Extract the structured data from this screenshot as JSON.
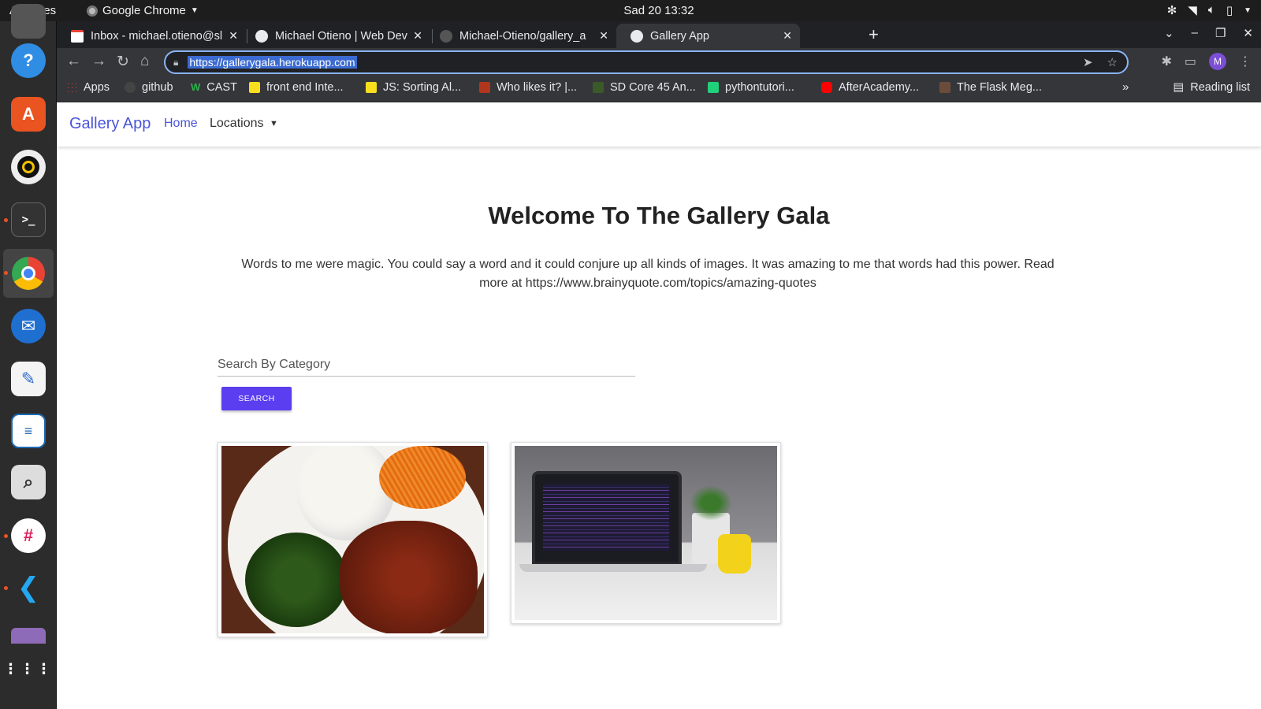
{
  "topbar": {
    "activities": "Activities",
    "app_name": "Google Chrome",
    "clock": "Sad 20  13:32"
  },
  "dock": {
    "items": [
      "help-icon",
      "software-center-icon",
      "rhythmbox-icon",
      "terminal-icon",
      "chrome-icon",
      "thunderbird-icon",
      "text-editor-icon",
      "libreoffice-writer-icon",
      "image-viewer-icon",
      "slack-icon",
      "vscode-icon",
      "app-grid-icon"
    ]
  },
  "tabs": [
    {
      "title": "Inbox - michael.otieno@sl",
      "favicon": "gmail-icon"
    },
    {
      "title": "Michael Otieno | Web Dev",
      "favicon": "globe-icon"
    },
    {
      "title": "Michael-Otieno/gallery_a",
      "favicon": "github-icon"
    },
    {
      "title": "Gallery App",
      "favicon": "globe-icon",
      "active": true
    }
  ],
  "omnibox": {
    "url": "https://gallerygala.herokuapp.com"
  },
  "avatar_initial": "M",
  "bookmarks": [
    {
      "label": "Apps",
      "icon": "apps-grid-icon"
    },
    {
      "label": "github",
      "icon": "github-icon"
    },
    {
      "label": "CAST",
      "icon": "cast-icon"
    },
    {
      "label": "front end Inte...",
      "icon": "js-icon"
    },
    {
      "label": "JS: Sorting Al...",
      "icon": "js-icon"
    },
    {
      "label": "Who likes it? |...",
      "icon": "codewars-icon"
    },
    {
      "label": "SD Core 45 An...",
      "icon": "leaf-icon"
    },
    {
      "label": "pythontutori...",
      "icon": "pythontutor-icon"
    },
    {
      "label": "AfterAcademy...",
      "icon": "youtube-icon"
    },
    {
      "label": "The Flask Meg...",
      "icon": "avatar-icon"
    }
  ],
  "reading_list": "Reading list",
  "navbar": {
    "brand": "Gallery App",
    "home": "Home",
    "locations": "Locations"
  },
  "main": {
    "heading": "Welcome To The Gallery Gala",
    "intro": "Words to me were magic. You could say a word and it could conjure up all kinds of images. It was amazing to me that words had this power. Read more at https://www.brainyquote.com/topics/amazing-quotes",
    "search_placeholder": "Search By Category",
    "search_button": "SEARCH"
  },
  "gallery": [
    {
      "subject": "plate of ugali with sukuma wiki, carrots and meat stew"
    },
    {
      "subject": "laptop showing code with potted plant and yellow mug"
    }
  ],
  "colors": {
    "brand": "#4a55d8",
    "search_button": "#5a3ef0",
    "chrome_dark": "#202124",
    "dock": "#2c2c2c"
  }
}
